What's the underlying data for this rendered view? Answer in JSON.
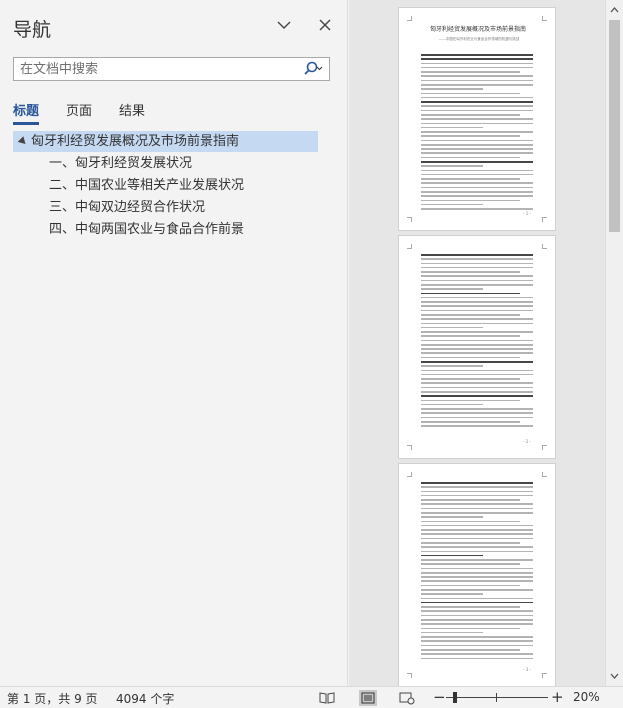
{
  "nav": {
    "title": "导航",
    "search_placeholder": "在文档中搜索",
    "tabs": [
      "标题",
      "页面",
      "结果"
    ],
    "tree": {
      "root": "匈牙利经贸发展概况及市场前景指南",
      "children": [
        "一、匈牙利经贸发展状况",
        "二、中国农业等相关产业发展状况",
        "三、中匈双边经贸合作状况",
        "四、中匈两国农业与食品合作前景"
      ]
    }
  },
  "doc": {
    "page1_title": "匈牙利经贸发展概况及市场前景指南",
    "page1_subtitle": "——中国在匈牙利农业与食品合作领域的机遇与挑战",
    "page_numbers": [
      "- 1 -",
      "- 2 -",
      "- 3 -"
    ]
  },
  "status": {
    "page_info": "第 1 页，共 9 页",
    "word_count": "4094 个字",
    "zoom": "20%"
  },
  "colors": {
    "accent": "#2b579a",
    "selection": "#c5daf2"
  },
  "icons": [
    "chevron-down-icon",
    "close-icon",
    "search-icon",
    "read-mode-icon",
    "print-layout-icon",
    "web-layout-icon"
  ]
}
